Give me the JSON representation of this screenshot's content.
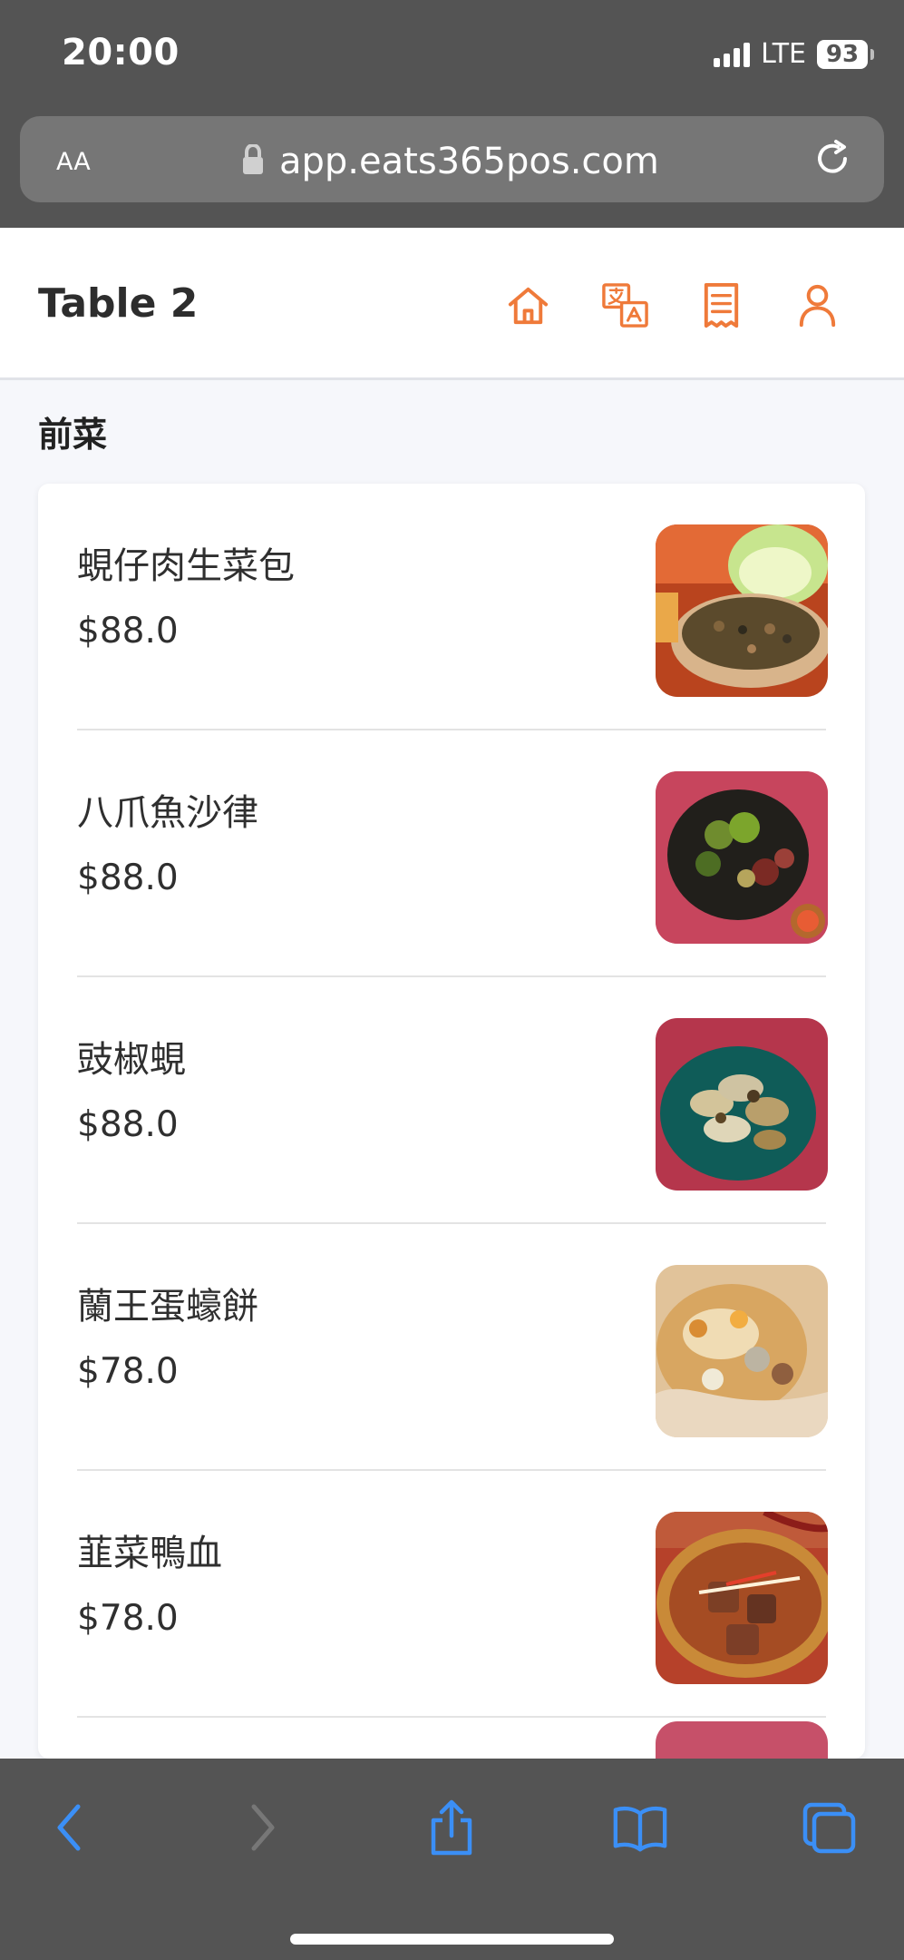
{
  "status": {
    "time": "20:00",
    "network": "LTE",
    "battery": "93"
  },
  "browser": {
    "aa": "AA",
    "url": "app.eats365pos.com"
  },
  "header": {
    "title": "Table 2",
    "icons": [
      "home-icon",
      "translate-icon",
      "receipt-icon",
      "user-icon"
    ],
    "accent": "#ef7a3a"
  },
  "category": {
    "title": "前菜"
  },
  "menu": {
    "items": [
      {
        "name": "蜆仔肉生菜包",
        "price": "$88.0"
      },
      {
        "name": "八爪魚沙律",
        "price": "$88.0"
      },
      {
        "name": "豉椒蜆",
        "price": "$88.0"
      },
      {
        "name": "蘭王蛋蠔餅",
        "price": "$78.0"
      },
      {
        "name": "韮菜鴨血",
        "price": "$78.0"
      }
    ]
  },
  "toolbar": {
    "icons": [
      "back-icon",
      "forward-icon",
      "share-icon",
      "bookmarks-icon",
      "tabs-icon"
    ],
    "color": "#3b8ff6"
  }
}
